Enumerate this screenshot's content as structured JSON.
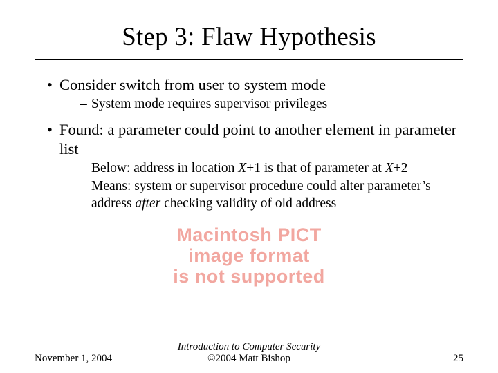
{
  "title": "Step 3: Flaw Hypothesis",
  "bullets": {
    "b1": "Consider switch from user to system mode",
    "b1a": "System mode requires supervisor privileges",
    "b2": "Found: a parameter could point to another element in parameter list",
    "b2a_pre": "Below: address in location ",
    "b2a_x1": "X",
    "b2a_mid1": "+1 is that of parameter at ",
    "b2a_x2": "X",
    "b2a_post": "+2",
    "b2b_pre": "Means: system or supervisor procedure could alter parameter’s address ",
    "b2b_italic": "after",
    "b2b_post": " checking validity of old address"
  },
  "placeholder": {
    "l1": "Macintosh PICT",
    "l2": "image format",
    "l3": "is not supported"
  },
  "footer": {
    "date": "November 1, 2004",
    "center1": "Introduction to Computer Security",
    "center2": "©2004 Matt Bishop",
    "page": "25"
  }
}
